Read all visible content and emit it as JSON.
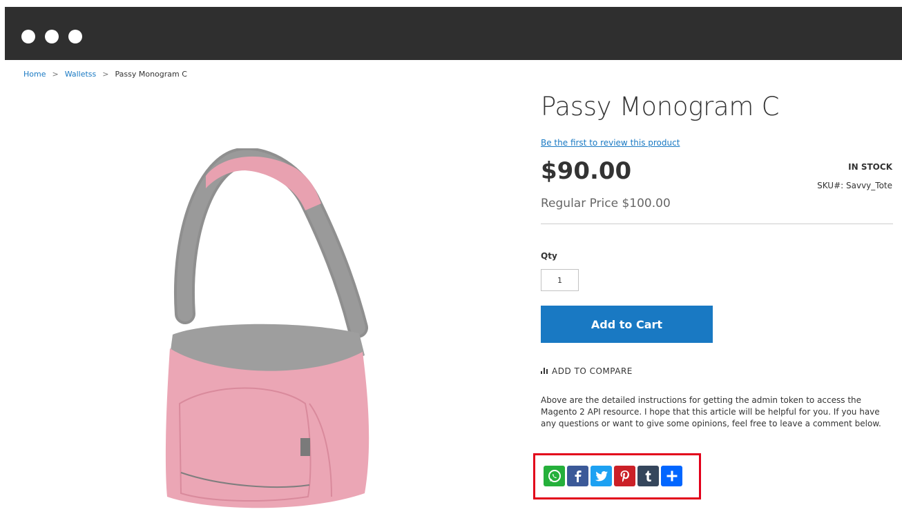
{
  "breadcrumb": {
    "home": "Home",
    "category": "Walletss",
    "current": "Passy Monogram C",
    "separator": ">"
  },
  "product": {
    "title": "Passy Monogram C",
    "review_link": "Be the first to review this product",
    "price": "$90.00",
    "stock": "IN STOCK",
    "sku": "SKU#:  Savvy_Tote",
    "regular_price": "Regular Price $100.00",
    "qty_label": "Qty",
    "qty_value": "1",
    "add_to_cart": "Add to Cart",
    "compare": "ADD TO COMPARE",
    "description": "Above are the detailed instructions for getting the admin token to access the Magento 2 API resource. I hope that this article will be helpful for you. If you have any questions or want to give some opinions, feel free to leave a comment below."
  },
  "share": [
    {
      "icon": "whatsapp-icon",
      "color": "#25b03b"
    },
    {
      "icon": "facebook-icon",
      "color": "#3b5998"
    },
    {
      "icon": "twitter-icon",
      "color": "#1da1f2"
    },
    {
      "icon": "pinterest-icon",
      "color": "#cb2027"
    },
    {
      "icon": "tumblr-icon",
      "color": "#35465c"
    },
    {
      "icon": "share-plus-icon",
      "color": "#0166ff"
    }
  ],
  "colors": {
    "accent": "#1979c3",
    "highlight": "#e2001a",
    "topbar": "#2f2f2f"
  }
}
